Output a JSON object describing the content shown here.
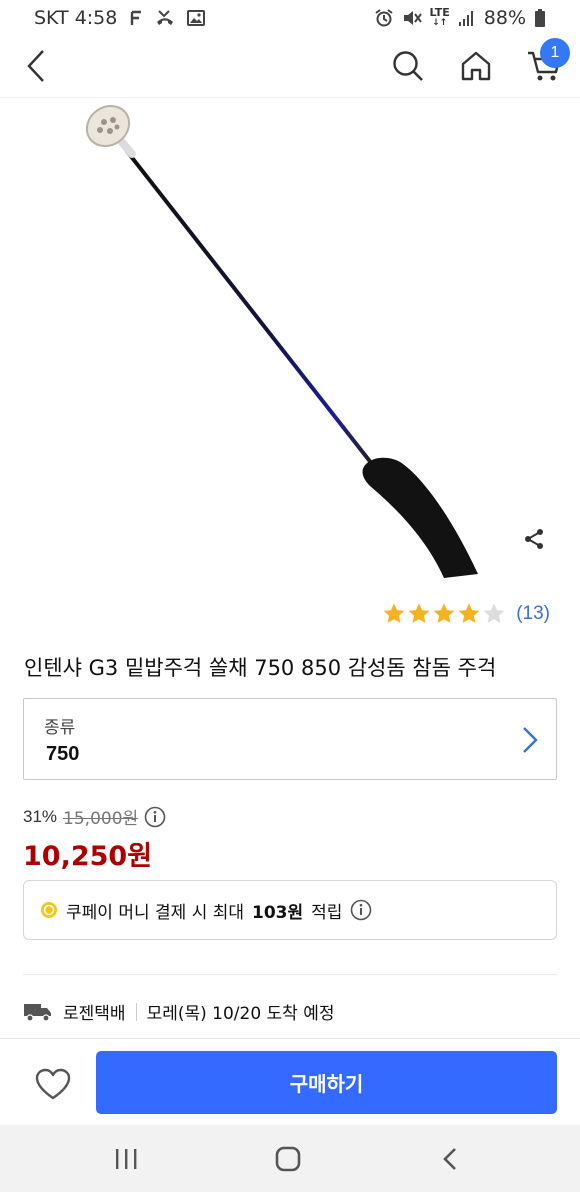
{
  "status_bar": {
    "carrier_time": "SKT 4:58",
    "network": "LTE",
    "battery": "88%",
    "icons": [
      "f-notification-icon",
      "missed-call-icon",
      "image-icon",
      "alarm-icon",
      "mute-icon",
      "signal-icon",
      "battery-icon"
    ]
  },
  "nav": {
    "cart_count": "1",
    "icons": [
      "back-icon",
      "search-icon",
      "home-icon",
      "cart-icon"
    ]
  },
  "product": {
    "rating": 4,
    "rating_max": 5,
    "review_count": "(13)",
    "title": "인텐샤 G3 밑밥주걱 쏠채 750 850 감성돔 참돔 주걱"
  },
  "option": {
    "label": "종류",
    "value": "750"
  },
  "price": {
    "discount": "31%",
    "original": "15,000원",
    "sale": "10,250원"
  },
  "coupay": {
    "prefix": "쿠페이 머니 결제 시 최대",
    "amount": "103원",
    "suffix": "적립"
  },
  "delivery": {
    "carrier": "로젠택배",
    "arrival": "모레(목) 10/20 도착 예정"
  },
  "bottom_bar": {
    "buy_label": "구매하기"
  },
  "colors": {
    "accent": "#346aff",
    "sale_price": "#ae0000",
    "star": "#f5b324",
    "badge": "#3478f6"
  }
}
